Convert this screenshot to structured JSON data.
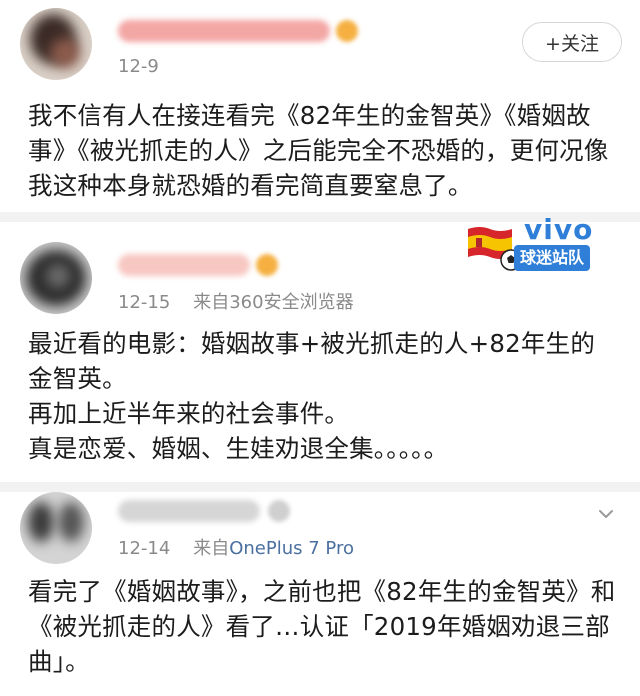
{
  "post1": {
    "time": "12-9",
    "follow_label": "+关注",
    "paragraphs": [
      "我不信有人在接连看完《82年生的金智英》《婚姻故事》《被光抓走的人》之后能完全不恐婚的，更何况像我这种本身就恐婚的看完简直要窒息了。"
    ]
  },
  "post2": {
    "time": "12-15",
    "source_prefix": "来自",
    "source_device": "360安全浏览器",
    "badge": {
      "brand": "vivo",
      "team": "球迷站队"
    },
    "paragraphs": [
      "最近看的电影：婚姻故事+被光抓走的人+82年生的金智英。",
      "再加上近半年来的社会事件。",
      "真是恋爱、婚姻、生娃劝退全集。。。。。"
    ]
  },
  "post3": {
    "time": "12-14",
    "source_prefix": "来自",
    "source_device": "OnePlus 7 Pro",
    "paragraphs": [
      "看完了《婚姻故事》，之前也把《82年生的金智英》和《被光抓走的人》看了…认证「2019年婚姻劝退三部曲」。"
    ]
  },
  "colors": {
    "link": "#4a6fa0",
    "meta": "#8a8a8a",
    "vivo_blue": "#2f7fd8",
    "divider": "#f2f2f2"
  },
  "icons": {
    "chevron": "chevron-down-icon",
    "flag": "spain-flag-icon",
    "ball": "soccer-ball-icon",
    "verified": "verified-badge-icon"
  }
}
